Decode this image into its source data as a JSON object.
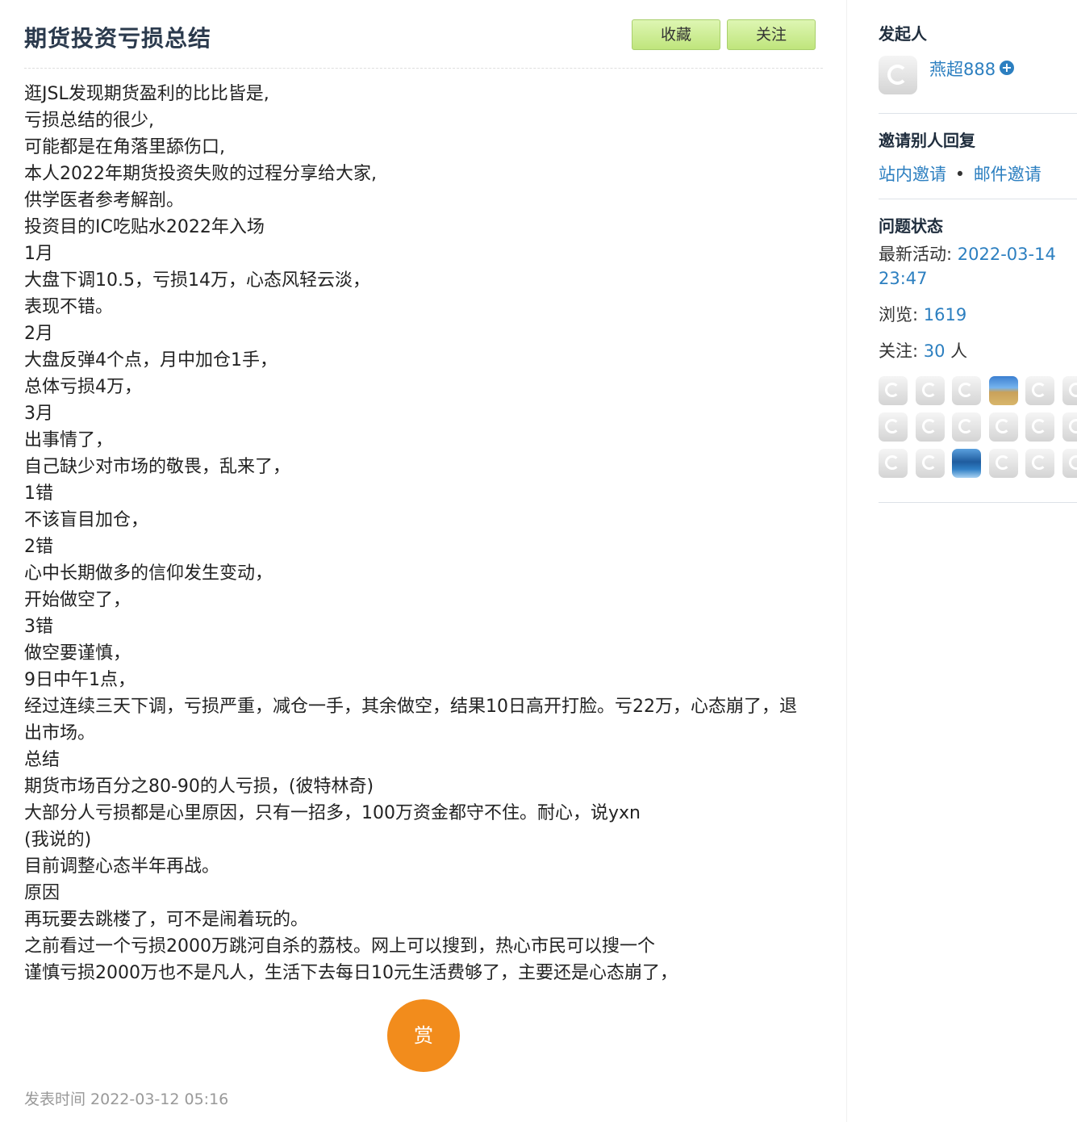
{
  "post": {
    "title": "期货投资亏损总结",
    "buttons": {
      "favorite": "收藏",
      "follow": "关注"
    },
    "lines": [
      "逛JSL发现期货盈利的比比皆是,",
      "亏损总结的很少,",
      "可能都是在角落里舔伤口,",
      "本人2022年期货投资失败的过程分享给大家,",
      "供学医者参考解剖。",
      "投资目的IC吃贴水2022年入场",
      "1月",
      "大盘下调10.5，亏损14万，心态风轻云淡，",
      "表现不错。",
      "2月",
      "大盘反弹4个点，月中加仓1手，",
      "总体亏损4万，",
      "3月",
      "出事情了，",
      "自己缺少对市场的敬畏，乱来了，",
      "1错",
      "不该盲目加仓，",
      "2错",
      "心中长期做多的信仰发生变动，",
      "开始做空了，",
      "3错",
      "做空要谨慎，",
      "9日中午1点，",
      "经过连续三天下调，亏损严重，减仓一手，其余做空，结果10日高开打脸。亏22万，心态崩了，退出市场。",
      "总结",
      "期货市场百分之80-90的人亏损，(彼特林奇)",
      "大部分人亏损都是心里原因，只有一招多，100万资金都守不住。耐心，说yxn",
      "(我说的)",
      "目前调整心态半年再战。",
      "原因",
      "再玩要去跳楼了，可不是闹着玩的。",
      "之前看过一个亏损2000万跳河自杀的荔枝。网上可以搜到，热心市民可以搜一个",
      "谨慎亏损2000万也不是凡人，生活下去每日10元生活费够了，主要还是心态崩了，"
    ],
    "reward_label": "赏",
    "published": "发表时间 2022-03-12 05:16"
  },
  "sidebar": {
    "initiator_heading": "发起人",
    "author_name": "燕超888",
    "invite_heading": "邀请别人回复",
    "invite_site": "站内邀请",
    "invite_dot": "•",
    "invite_mail": "邮件邀请",
    "status_heading": "问题状态",
    "latest_label": "最新活动: ",
    "latest_value": "2022-03-14 23:47",
    "views_label": "浏览: ",
    "views_value": "1619",
    "followers_label": "关注: ",
    "followers_value": "30",
    "followers_unit": " 人"
  },
  "colors": {
    "link": "#2c7fc0",
    "reward": "#f28c1c",
    "button": "#cdeb93"
  }
}
